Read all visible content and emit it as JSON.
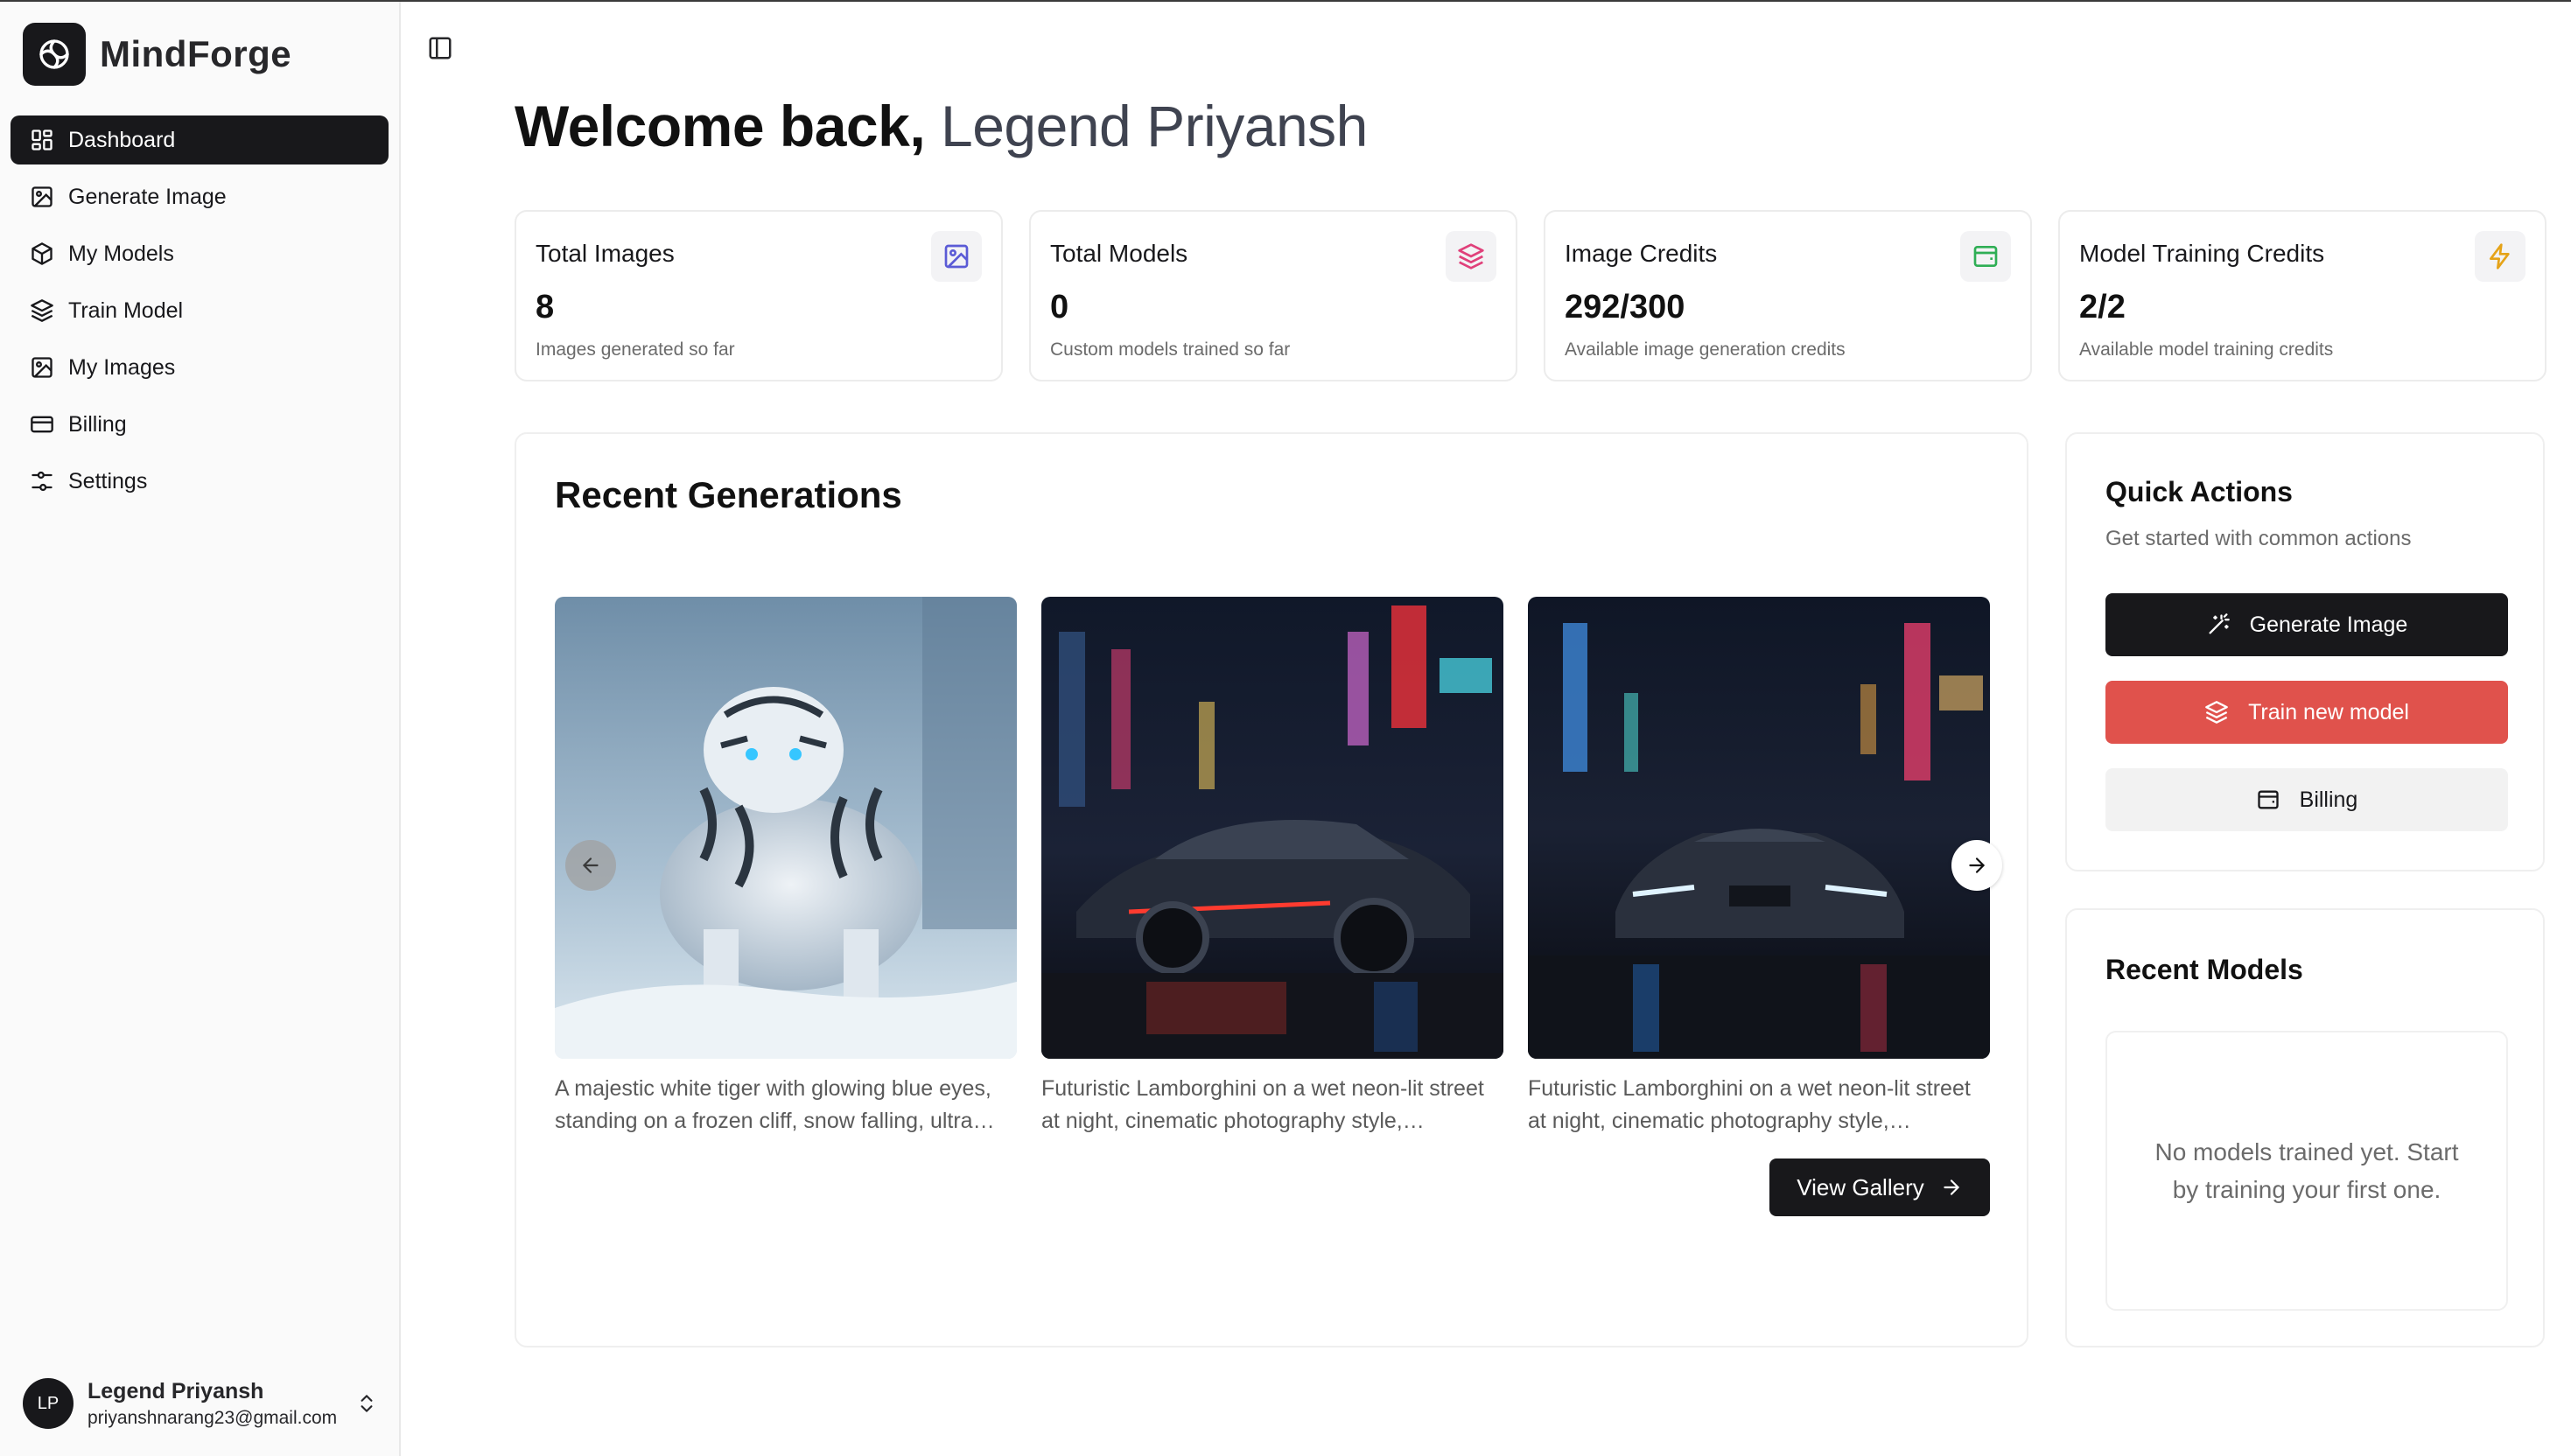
{
  "app": {
    "name": "MindForge"
  },
  "sidebar": {
    "items": [
      {
        "label": "Dashboard",
        "icon": "dashboard-icon",
        "active": true
      },
      {
        "label": "Generate Image",
        "icon": "image-icon"
      },
      {
        "label": "My Models",
        "icon": "cube-icon"
      },
      {
        "label": "Train Model",
        "icon": "layers-icon"
      },
      {
        "label": "My Images",
        "icon": "images-icon"
      },
      {
        "label": "Billing",
        "icon": "credit-card-icon"
      },
      {
        "label": "Settings",
        "icon": "settings-icon"
      }
    ],
    "user": {
      "initials": "LP",
      "name": "Legend Priyansh",
      "email": "priyanshnarang23@gmail.com"
    }
  },
  "welcome": {
    "prefix": "Welcome back,",
    "name": "Legend Priyansh"
  },
  "stats": [
    {
      "title": "Total Images",
      "value": "8",
      "sub": "Images generated so far",
      "icon": "image-icon",
      "color": "#5b5bd6"
    },
    {
      "title": "Total Models",
      "value": "0",
      "sub": "Custom models trained so far",
      "icon": "layers-icon",
      "color": "#e0407a"
    },
    {
      "title": "Image Credits",
      "value": "292/300",
      "sub": "Available image generation credits",
      "icon": "wallet-icon",
      "color": "#2fae55"
    },
    {
      "title": "Model Training Credits",
      "value": "2/2",
      "sub": "Available model training credits",
      "icon": "zap-icon",
      "color": "#e5a318"
    }
  ],
  "recent_generations": {
    "title": "Recent Generations",
    "images": [
      {
        "caption": "A majestic white tiger with glowing blue eyes, standing on a frozen cliff, snow falling, ultra realistic"
      },
      {
        "caption": "Futuristic Lamborghini on a wet neon-lit street at night, cinematic photography style, reflections"
      },
      {
        "caption": "Futuristic Lamborghini on a wet neon-lit street at night, cinematic photography style, reflections"
      }
    ],
    "view_gallery": "View Gallery"
  },
  "quick_actions": {
    "title": "Quick Actions",
    "subtitle": "Get started with common actions",
    "buttons": [
      {
        "label": "Generate Image",
        "icon": "wand-icon"
      },
      {
        "label": "Train new model",
        "icon": "layers-icon"
      },
      {
        "label": "Billing",
        "icon": "wallet-icon"
      }
    ]
  },
  "recent_models": {
    "title": "Recent Models",
    "empty": "No models trained yet. Start by training your first one."
  },
  "colors": {
    "primary": "#18181b",
    "danger": "#e0524c",
    "sidebar_bg": "#fafafa"
  }
}
